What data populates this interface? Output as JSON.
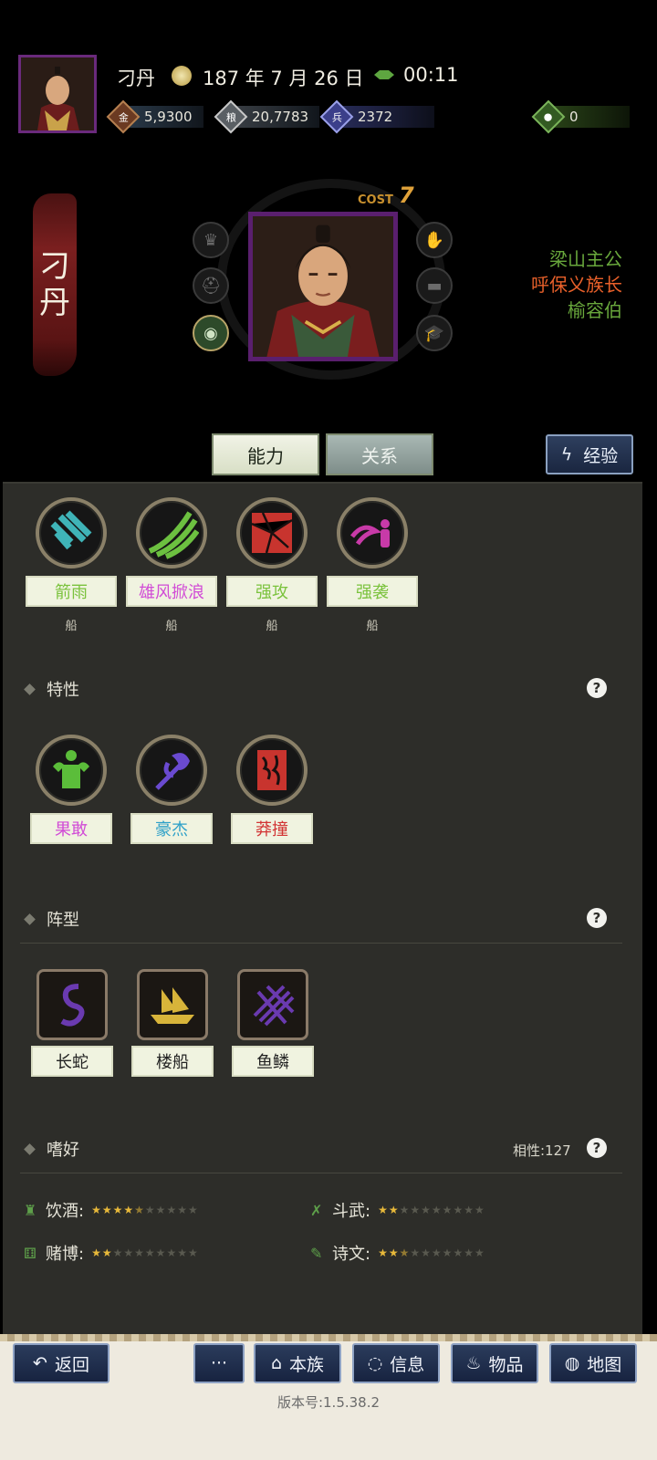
{
  "header": {
    "character_name": "刁丹",
    "date": "187 年 7 月 26 日",
    "time": "00:11",
    "resources": {
      "gold": "5,9300",
      "silver": "20,7783",
      "troops": "2372",
      "food": "0"
    }
  },
  "hero": {
    "name_chars": [
      "刁",
      "丹"
    ],
    "cost_label": "COST",
    "cost_value": "7",
    "titles": [
      {
        "text": "梁山主公",
        "color": "#69a83c"
      },
      {
        "text": "呼保义族长",
        "color": "#e8602a"
      },
      {
        "text": "榆容伯",
        "color": "#69a83c"
      }
    ]
  },
  "tabs": {
    "ability": "能力",
    "relation": "关系",
    "experience": "经验"
  },
  "skills": [
    {
      "name": "箭雨",
      "color": "#7ac23c",
      "sub": "船",
      "icon": "arrow-rain-icon"
    },
    {
      "name": "雄风掀浪",
      "color": "#d14bd6",
      "sub": "船",
      "icon": "wave-icon"
    },
    {
      "name": "强攻",
      "color": "#7ac23c",
      "sub": "船",
      "icon": "shatter-icon"
    },
    {
      "name": "强袭",
      "color": "#7ac23c",
      "sub": "船",
      "icon": "assault-icon"
    }
  ],
  "traits": {
    "title": "特性",
    "items": [
      {
        "name": "果敢",
        "color": "#d14bd6",
        "icon": "strongman-icon"
      },
      {
        "name": "豪杰",
        "color": "#2ea0c8",
        "icon": "axe-icon"
      },
      {
        "name": "莽撞",
        "color": "#d23434",
        "icon": "reckless-icon"
      }
    ]
  },
  "formations": {
    "title": "阵型",
    "items": [
      {
        "name": "长蛇",
        "icon": "snake-icon"
      },
      {
        "name": "楼船",
        "icon": "ship-icon"
      },
      {
        "name": "鱼鳞",
        "icon": "fish-scale-icon"
      }
    ]
  },
  "hobbies": {
    "title": "嗜好",
    "affinity": "相性:127",
    "items": [
      {
        "name": "饮酒:",
        "stars": 4.5,
        "icon": "wine-icon"
      },
      {
        "name": "斗武:",
        "stars": 2,
        "icon": "martial-icon"
      },
      {
        "name": "赌博:",
        "stars": 2,
        "icon": "dice-icon"
      },
      {
        "name": "诗文:",
        "stars": 2.5,
        "icon": "poetry-icon"
      }
    ]
  },
  "bottom_nav": {
    "back": "返回",
    "more": "···",
    "clan": "本族",
    "info": "信息",
    "items": "物品",
    "map": "地图"
  },
  "version": "版本号:1.5.38.2",
  "help_mark": "?"
}
